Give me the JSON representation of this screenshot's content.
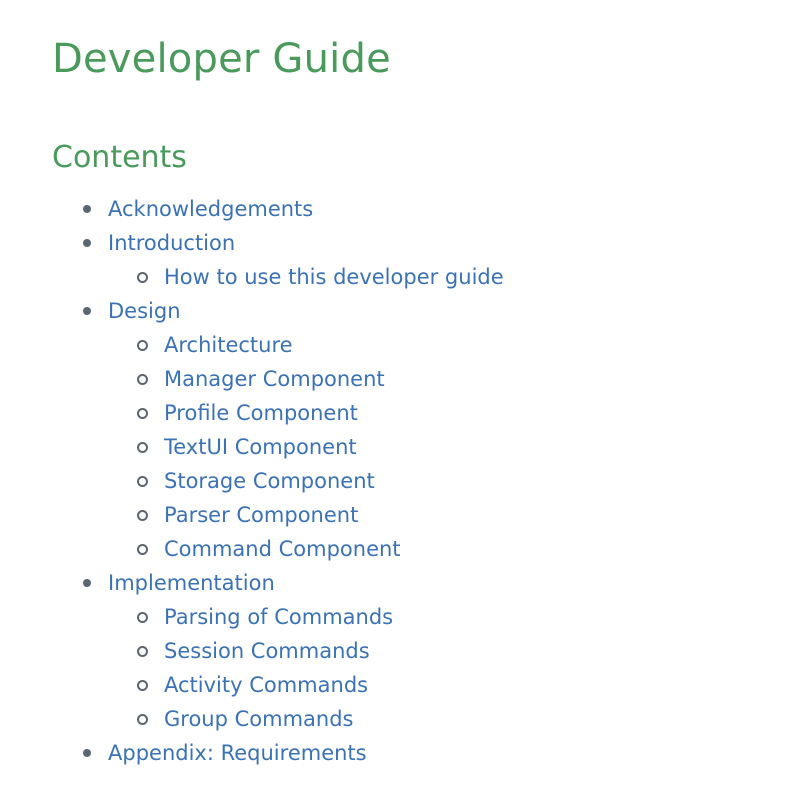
{
  "page": {
    "title": "Developer Guide",
    "section_heading": "Contents"
  },
  "toc": [
    {
      "label": "Acknowledgements",
      "children": []
    },
    {
      "label": "Introduction",
      "children": [
        {
          "label": "How to use this developer guide"
        }
      ]
    },
    {
      "label": "Design",
      "children": [
        {
          "label": "Architecture"
        },
        {
          "label": "Manager Component"
        },
        {
          "label": "Profile Component"
        },
        {
          "label": "TextUI Component"
        },
        {
          "label": "Storage Component"
        },
        {
          "label": "Parser Component"
        },
        {
          "label": "Command Component"
        }
      ]
    },
    {
      "label": "Implementation",
      "children": [
        {
          "label": "Parsing of Commands"
        },
        {
          "label": "Session Commands"
        },
        {
          "label": "Activity Commands"
        },
        {
          "label": "Group Commands"
        }
      ]
    },
    {
      "label": "Appendix: Requirements",
      "children": []
    }
  ],
  "colors": {
    "heading": "#4a9a5c",
    "link": "#3b72b5",
    "bullet": "#5b6670"
  }
}
